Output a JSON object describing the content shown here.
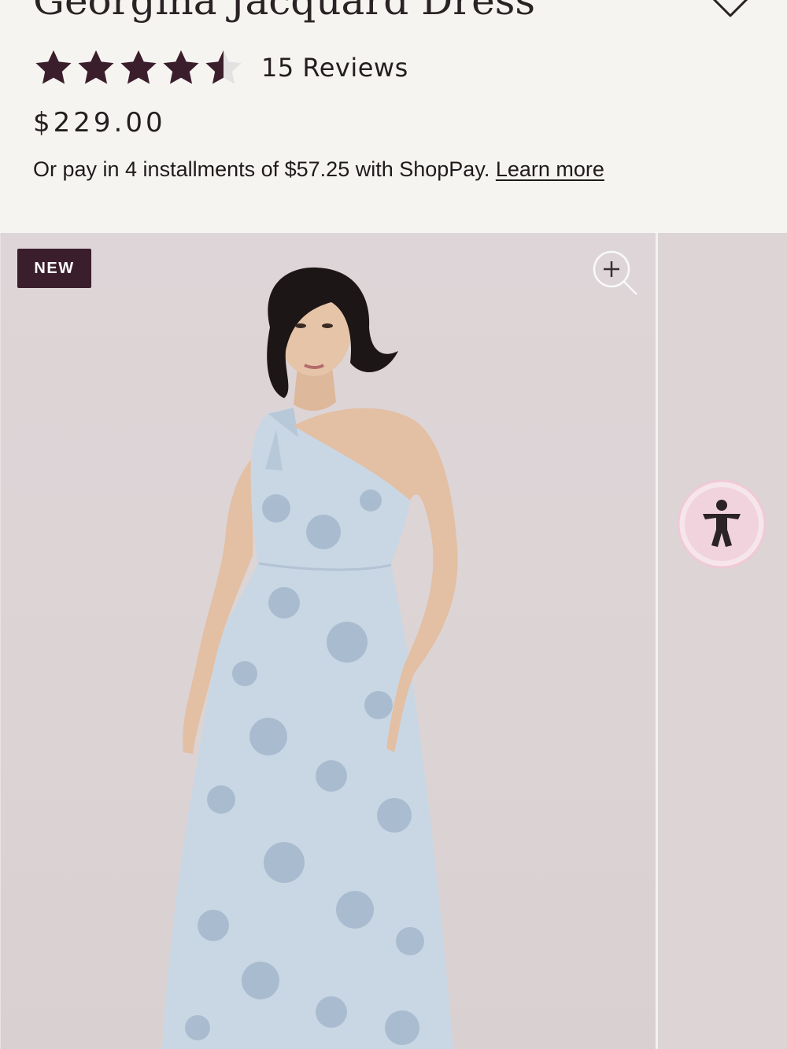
{
  "product": {
    "title": "Georgina Jacquard Dress",
    "rating": 4.5,
    "rating_max": 5,
    "reviews_label": "15 Reviews",
    "price": "$229.00",
    "installments_text": "Or pay in 4 installments of $57.25 with ShopPay.",
    "learn_more": "Learn more"
  },
  "gallery": {
    "badge": "NEW",
    "zoom_icon": "zoom-in-icon",
    "accessibility_icon": "accessibility-icon"
  },
  "colors": {
    "star": "#3b1e2c",
    "badge_bg": "#3b1e2c",
    "gallery_bg": "#dcd4d5",
    "accessibility_bg": "#f1d3dd",
    "dress": "#c9d7e4"
  }
}
